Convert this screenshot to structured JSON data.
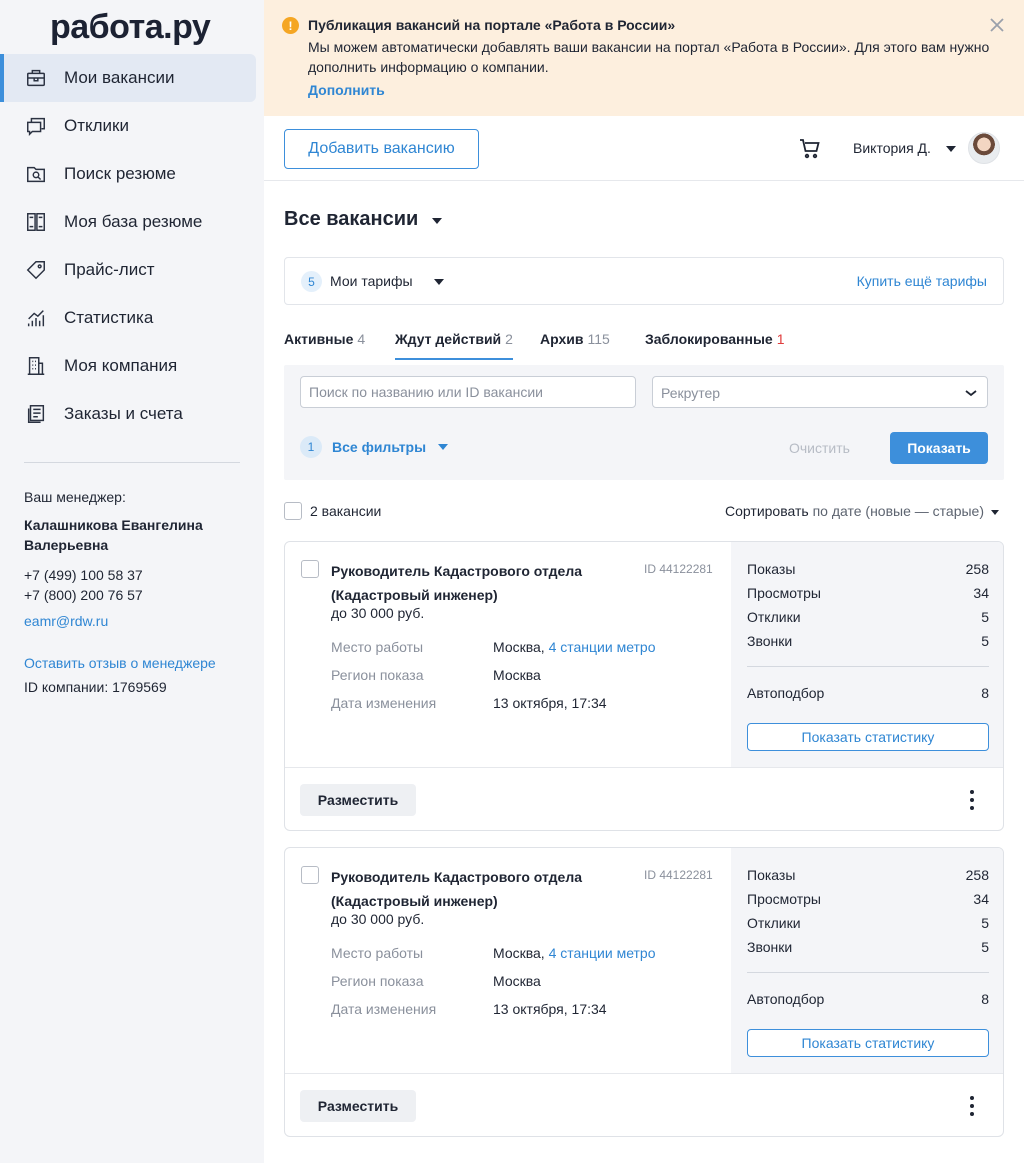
{
  "brand": {
    "logo": "работа.ру"
  },
  "sidebar": {
    "items": [
      {
        "label": "Мои вакансии",
        "icon": "briefcase-icon"
      },
      {
        "label": "Отклики",
        "icon": "chat-bubbles-icon"
      },
      {
        "label": "Поиск резюме",
        "icon": "folder-search-icon"
      },
      {
        "label": "Моя база резюме",
        "icon": "resume-base-icon"
      },
      {
        "label": "Прайс-лист",
        "icon": "price-tag-icon"
      },
      {
        "label": "Статистика",
        "icon": "stats-icon"
      },
      {
        "label": "Моя компания",
        "icon": "building-icon"
      },
      {
        "label": "Заказы и счета",
        "icon": "documents-icon"
      }
    ],
    "manager": {
      "label": "Ваш менеджер:",
      "name": "Калашникова Евангелина Валерьевна",
      "phone1": "+7 (499) 100 58 37",
      "phone2": "+7 (800) 200 76 57",
      "email": "eamr@rdw.ru",
      "feedback": "Оставить отзыв о менеджере",
      "company_id": "ID компании: 1769569"
    }
  },
  "banner": {
    "title": "Публикация вакансий на портале «Работа в России»",
    "text": "Мы можем автоматически добавлять ваши вакансии на портал «Работа в России». Для этого вам нужно дополнить информацию о компании.",
    "link": "Дополнить",
    "icon_color": "#f5a623"
  },
  "header": {
    "add_button": "Добавить вакансию",
    "user_name": "Виктория Д."
  },
  "main": {
    "title": "Все вакансии",
    "tariffs": {
      "count": "5",
      "label": "Мои тарифы",
      "buy": "Купить ещё тарифы"
    },
    "tabs": [
      {
        "label": "Активные",
        "count": "4"
      },
      {
        "label": "Ждут действий",
        "count": "2"
      },
      {
        "label": "Архив",
        "count": "115"
      },
      {
        "label": "Заблокированные",
        "count": "1"
      }
    ],
    "filters": {
      "search_placeholder": "Поиск по названию или ID вакансии",
      "recruiter_placeholder": "Рекрутер",
      "filters_count": "1",
      "all_filters": "Все фильтры",
      "clear": "Очистить",
      "show": "Показать"
    },
    "list": {
      "count": "2 вакансии",
      "sort_label": "Сортировать",
      "sort_value": "по дате (новые — старые)"
    },
    "vacancies": [
      {
        "title": "Руководитель Кадастрового отдела (Кадастровый инженер)",
        "id": "ID 44122281",
        "salary": "до 30 000 руб.",
        "place_label": "Место работы",
        "place_city": "Москва,",
        "place_metro": "4 станции метро",
        "region_label": "Регион показа",
        "region": "Москва",
        "date_label": "Дата изменения",
        "date": "13 октября, 17:34",
        "stats": [
          {
            "label": "Показы",
            "value": "258"
          },
          {
            "label": "Просмотры",
            "value": "34"
          },
          {
            "label": "Отклики",
            "value": "5"
          },
          {
            "label": "Звонки",
            "value": "5"
          }
        ],
        "autoselect_label": "Автоподбор",
        "autoselect": "8",
        "stats_button": "Показать статистику",
        "place_button": "Разместить"
      },
      {
        "title": "Руководитель Кадастрового отдела (Кадастровый инженер)",
        "id": "ID 44122281",
        "salary": "до 30 000 руб.",
        "place_label": "Место работы",
        "place_city": "Москва,",
        "place_metro": "4 станции метро",
        "region_label": "Регион показа",
        "region": "Москва",
        "date_label": "Дата изменения",
        "date": "13 октября, 17:34",
        "stats": [
          {
            "label": "Показы",
            "value": "258"
          },
          {
            "label": "Просмотры",
            "value": "34"
          },
          {
            "label": "Отклики",
            "value": "5"
          },
          {
            "label": "Звонки",
            "value": "5"
          }
        ],
        "autoselect_label": "Автоподбор",
        "autoselect": "8",
        "stats_button": "Показать статистику",
        "place_button": "Разместить"
      }
    ]
  },
  "colors": {
    "accent": "#3d8fdb",
    "link": "#2f86d3",
    "banner_bg": "#fdefde",
    "alert_red": "#e03c3c"
  }
}
